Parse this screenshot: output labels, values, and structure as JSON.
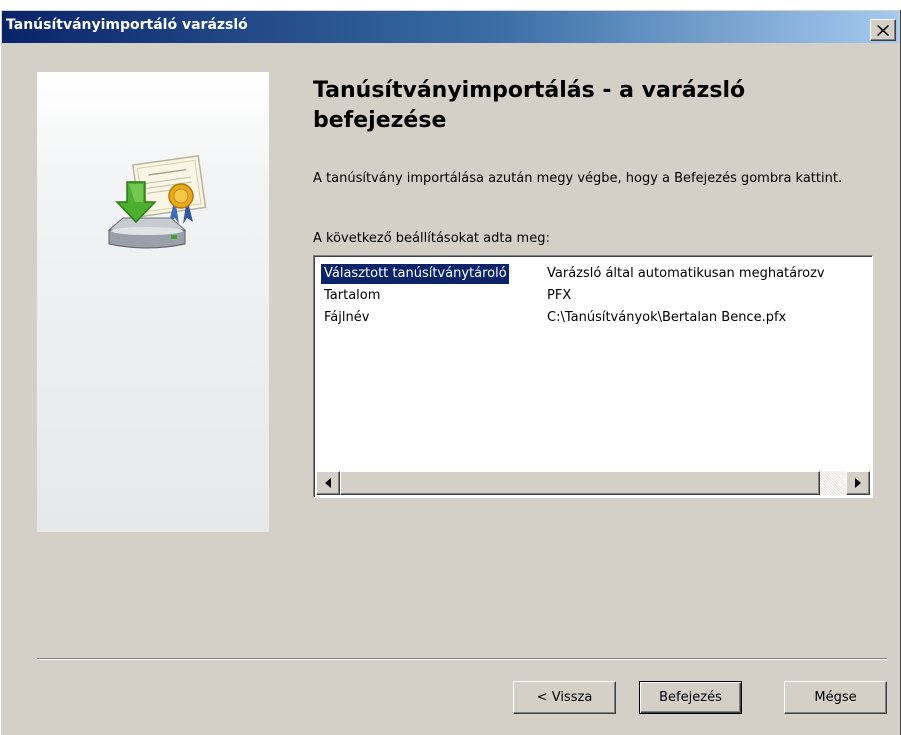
{
  "window": {
    "title": "Tanúsítványimportáló varázsló"
  },
  "main": {
    "heading": "Tanúsítványimportálás - a varázsló befejezése",
    "description": "A tanúsítvány importálása azután megy végbe, hogy a Befejezés gombra kattint.",
    "settings_label": "A következő beállításokat adta meg:",
    "settings": [
      {
        "name": "Választott tanúsítványtároló",
        "value": "Varázsló által automatikusan meghatározv"
      },
      {
        "name": "Tartalom",
        "value": "PFX"
      },
      {
        "name": "Fájlnév",
        "value": "C:\\Tanúsítványok\\Bertalan Bence.pfx"
      }
    ],
    "selected_row": 0
  },
  "buttons": {
    "back": "< Vissza",
    "finish": "Befejezés",
    "cancel": "Mégse"
  },
  "icons": {
    "close": "close-icon",
    "wizard": "certificate-import-icon",
    "scroll_left": "arrow-left-icon",
    "scroll_right": "arrow-right-icon"
  },
  "colors": {
    "titlebar_start": "#0a246a",
    "titlebar_end": "#a6caf0",
    "selection": "#0a246a",
    "face": "#d4d0c8"
  }
}
